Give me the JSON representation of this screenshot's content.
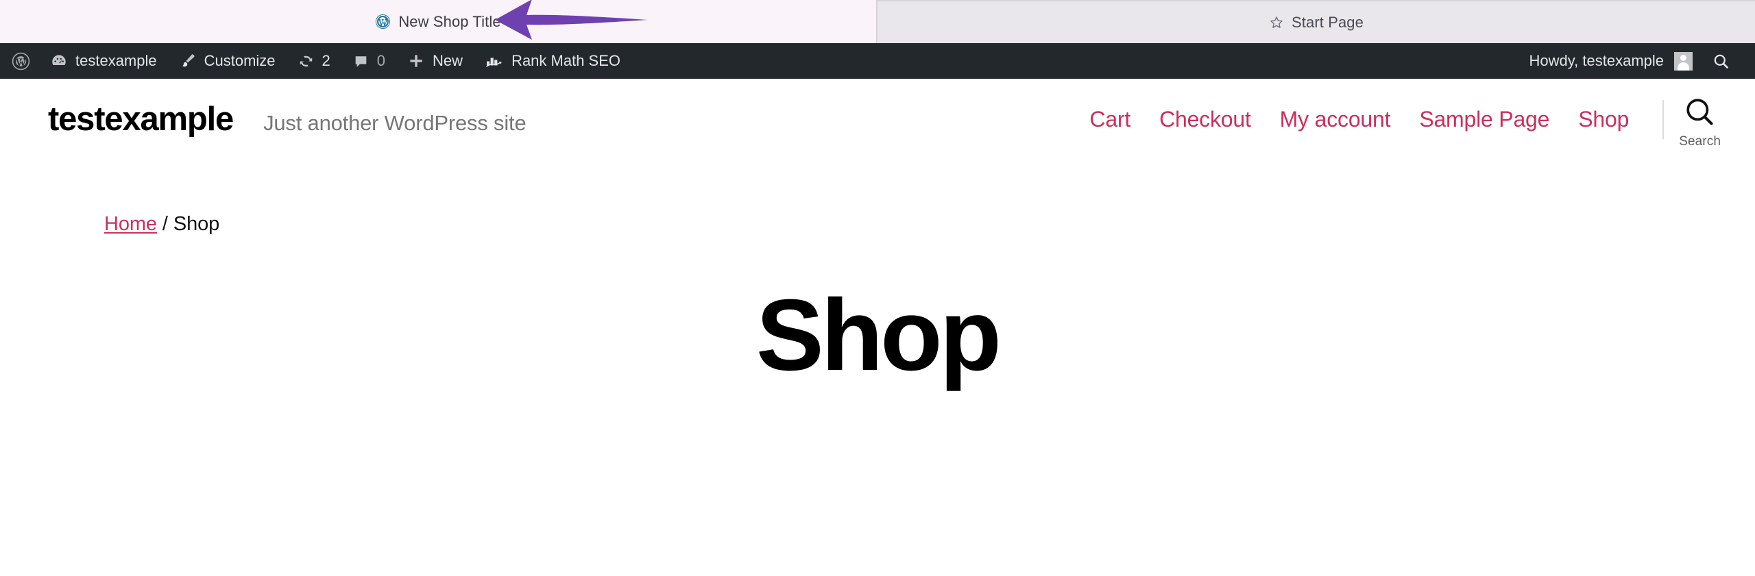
{
  "browser": {
    "tabs": [
      {
        "title": "New Shop Title",
        "favicon": "wordpress-icon",
        "active": true
      },
      {
        "title": "Start Page",
        "favicon": "star-icon",
        "active": false
      }
    ],
    "annotation": {
      "type": "arrow",
      "direction": "left",
      "color": "#6f41b0",
      "points_to": "New Shop Title"
    }
  },
  "admin_bar": {
    "background": "#23282d",
    "logo": "wordpress-icon",
    "items": [
      {
        "icon": "dashboard-icon",
        "label": "testexample"
      },
      {
        "icon": "brush-icon",
        "label": "Customize"
      },
      {
        "icon": "updates-icon",
        "label": "2"
      },
      {
        "icon": "comment-icon",
        "label": "0"
      },
      {
        "icon": "plus-icon",
        "label": "New"
      },
      {
        "icon": "rank-math-icon",
        "label": "Rank Math SEO"
      }
    ],
    "account": {
      "greeting": "Howdy, testexample",
      "avatar": "user-avatar",
      "search_icon": "search-icon"
    }
  },
  "site_header": {
    "title": "testexample",
    "tagline": "Just another WordPress site",
    "accent_color": "#cb2f5c",
    "nav": [
      {
        "label": "Cart"
      },
      {
        "label": "Checkout"
      },
      {
        "label": "My account"
      },
      {
        "label": "Sample Page"
      },
      {
        "label": "Shop"
      }
    ],
    "search": {
      "icon": "search-icon",
      "label": "Search"
    }
  },
  "main": {
    "breadcrumb": {
      "home": "Home",
      "separator": "/",
      "current": "Shop"
    },
    "page_title": "Shop"
  }
}
